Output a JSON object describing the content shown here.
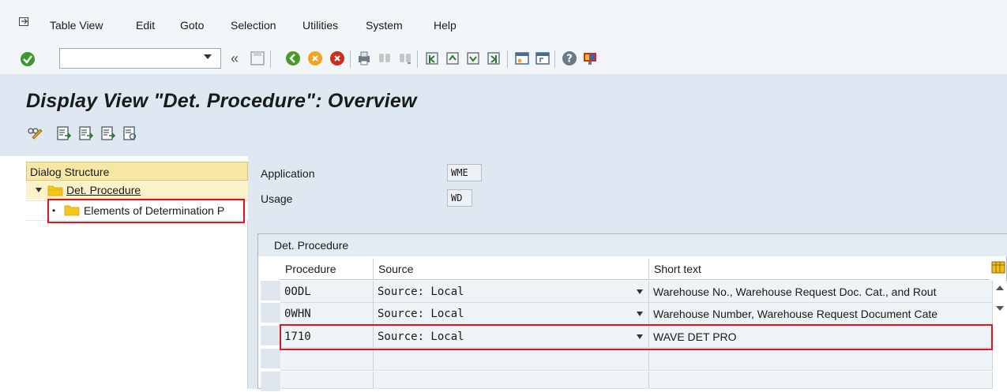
{
  "menubar": {
    "items": [
      "Table View",
      "Edit",
      "Goto",
      "Selection",
      "Utilities",
      "System",
      "Help"
    ]
  },
  "toolbar": {
    "command_value": "",
    "icons": [
      "enter-icon",
      "save-icon",
      "back-icon",
      "exit-icon",
      "cancel-icon",
      "print-icon",
      "find-icon",
      "find-next-icon",
      "first-page-icon",
      "previous-page-icon",
      "next-page-icon",
      "last-page-icon",
      "create-session-icon",
      "shortcut-icon",
      "help-icon",
      "customize-layout-icon"
    ]
  },
  "title": "Display View \"Det. Procedure\": Overview",
  "dialog_structure": {
    "header": "Dialog Structure",
    "items": [
      {
        "label": "Det. Procedure",
        "level": 1,
        "expanded": true
      },
      {
        "label": "Elements of Determination P",
        "level": 2
      }
    ]
  },
  "fields": {
    "application_label": "Application",
    "application_value": "WME",
    "usage_label": "Usage",
    "usage_value": "WD"
  },
  "table": {
    "title": "Det. Procedure",
    "columns": [
      "Procedure",
      "Source",
      "Short text"
    ],
    "rows": [
      {
        "procedure": "0ODL",
        "source": "Source: Local",
        "short_text": "Warehouse No., Warehouse Request Doc. Cat., and Rout"
      },
      {
        "procedure": "0WHN",
        "source": "Source: Local",
        "short_text": "Warehouse Number, Warehouse Request Document Cate"
      },
      {
        "procedure": "1710",
        "source": "Source: Local",
        "short_text": "WAVE DET PRO"
      }
    ]
  },
  "colors": {
    "accent_red": "#e0141e",
    "folder_yellow": "#f5c518",
    "header_bg": "#dfe8f1"
  }
}
